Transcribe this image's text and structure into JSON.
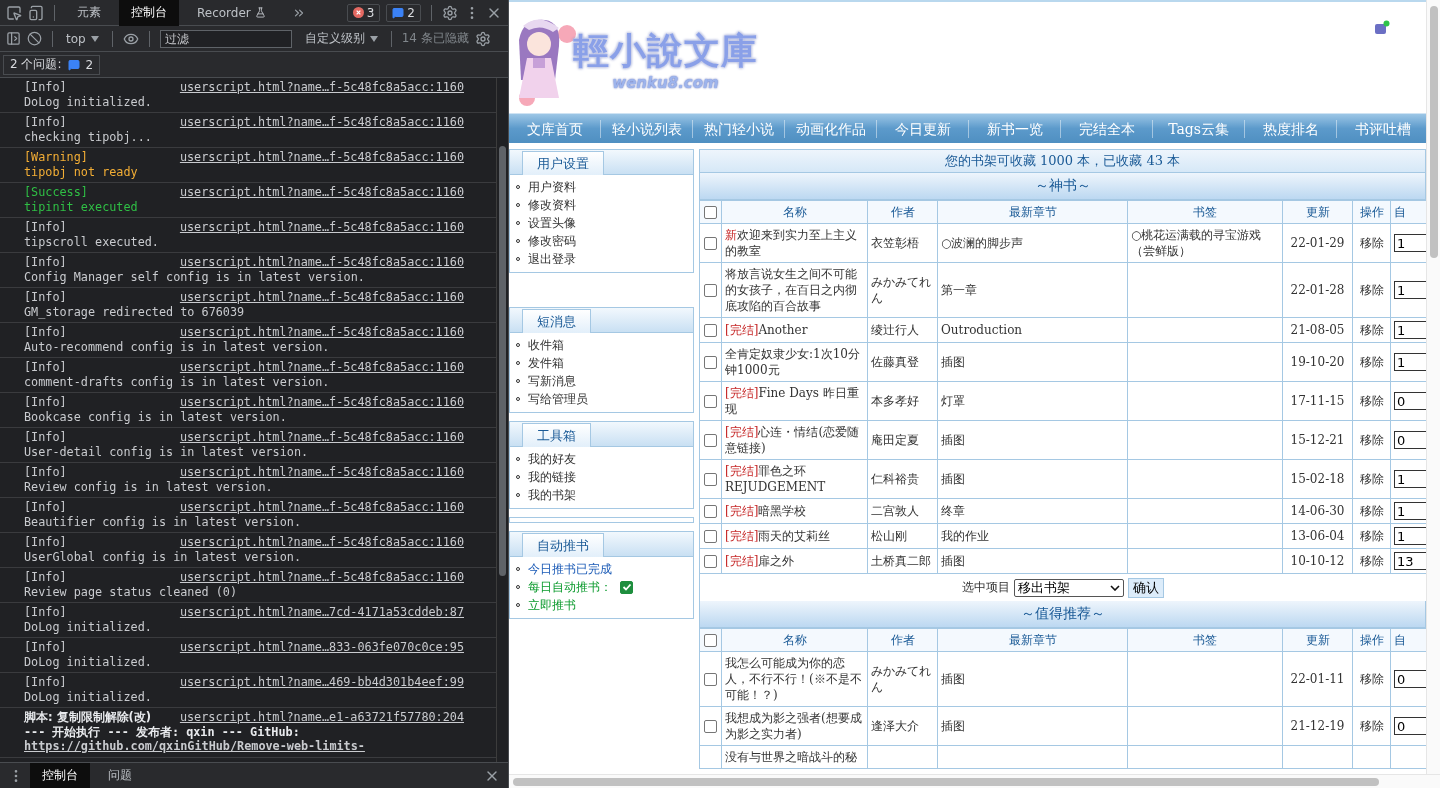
{
  "devtools": {
    "tabs": [
      {
        "label": "元素",
        "selected": false
      },
      {
        "label": "控制台",
        "selected": true
      },
      {
        "label": "Recorder",
        "selected": false
      }
    ],
    "error_count": "3",
    "message_count": "2",
    "context": "top",
    "filter_placeholder": "过滤",
    "levels": "自定义级别",
    "hidden": "14 条已隐藏",
    "issues": {
      "label": "2 个问题:",
      "count": "2"
    },
    "logs": [
      {
        "kind": "info",
        "level": "[Info]",
        "message": "DoLog initialized.",
        "source": "userscript.html?name…f-5c48fc8a5acc:1160"
      },
      {
        "kind": "info",
        "level": "[Info]",
        "message": "checking tipobj...",
        "source": "userscript.html?name…f-5c48fc8a5acc:1160"
      },
      {
        "kind": "warning",
        "level": "[Warning]",
        "message": "tipobj not ready",
        "source": "userscript.html?name…f-5c48fc8a5acc:1160"
      },
      {
        "kind": "success",
        "level": "[Success]",
        "message": "tipinit executed",
        "source": "userscript.html?name…f-5c48fc8a5acc:1160"
      },
      {
        "kind": "info",
        "level": "[Info]",
        "message": "tipscroll executed.",
        "source": "userscript.html?name…f-5c48fc8a5acc:1160"
      },
      {
        "kind": "info",
        "level": "[Info]",
        "message": "Config Manager self config is in latest version.",
        "source": "userscript.html?name…f-5c48fc8a5acc:1160"
      },
      {
        "kind": "info",
        "level": "[Info]",
        "message": "GM_storage redirected to 676039",
        "source": "userscript.html?name…f-5c48fc8a5acc:1160"
      },
      {
        "kind": "info",
        "level": "[Info]",
        "message": "Auto-recommend config is in latest version.",
        "source": "userscript.html?name…f-5c48fc8a5acc:1160"
      },
      {
        "kind": "info",
        "level": "[Info]",
        "message": "comment-drafts config is in latest version.",
        "source": "userscript.html?name…f-5c48fc8a5acc:1160"
      },
      {
        "kind": "info",
        "level": "[Info]",
        "message": "Bookcase config is in latest version.",
        "source": "userscript.html?name…f-5c48fc8a5acc:1160"
      },
      {
        "kind": "info",
        "level": "[Info]",
        "message": "User-detail config is in latest version.",
        "source": "userscript.html?name…f-5c48fc8a5acc:1160"
      },
      {
        "kind": "info",
        "level": "[Info]",
        "message": "Review config is in latest version.",
        "source": "userscript.html?name…f-5c48fc8a5acc:1160"
      },
      {
        "kind": "info",
        "level": "[Info]",
        "message": "Beautifier config is in latest version.",
        "source": "userscript.html?name…f-5c48fc8a5acc:1160"
      },
      {
        "kind": "info",
        "level": "[Info]",
        "message": "UserGlobal config is in latest version.",
        "source": "userscript.html?name…f-5c48fc8a5acc:1160"
      },
      {
        "kind": "info",
        "level": "[Info]",
        "message": "Review page status cleaned (0)",
        "source": "userscript.html?name…f-5c48fc8a5acc:1160"
      },
      {
        "kind": "info",
        "level": "[Info]",
        "message": "DoLog initialized.",
        "source": "userscript.html?name…7cd-4171a53cddeb:87"
      },
      {
        "kind": "info",
        "level": "[Info]",
        "message": "DoLog initialized.",
        "source": "userscript.html?name…833-063fe070c0ce:95"
      },
      {
        "kind": "info",
        "level": "[Info]",
        "message": "DoLog initialized.",
        "source": "userscript.html?name…469-bb4d301b4eef:99"
      },
      {
        "kind": "script",
        "level": "脚本: 复制限制解除(改)",
        "message": "--- 开始执行 --- 发布者: qxin --- GitHub: ",
        "link": "https://github.com/qxinGitHub/Remove-web-limits-",
        "source": "userscript.html?name…e1-a63721f57780:204"
      }
    ],
    "drawer_tabs": [
      {
        "label": "控制台",
        "selected": true
      },
      {
        "label": "问题",
        "selected": false
      }
    ]
  },
  "page": {
    "logo": {
      "title": "輕小說文庫",
      "subtitle": "wenku8.com"
    },
    "nav": [
      "文库首页",
      "轻小说列表",
      "热门轻小说",
      "动画化作品",
      "今日更新",
      "新书一览",
      "完结全本",
      "Tags云集",
      "热度排名",
      "书评吐槽"
    ],
    "sidebar": [
      {
        "title": "用户设置",
        "items": [
          {
            "kind": "link",
            "label": "用户资料"
          },
          {
            "kind": "link",
            "label": "修改资料"
          },
          {
            "kind": "link",
            "label": "设置头像"
          },
          {
            "kind": "link",
            "label": "修改密码"
          },
          {
            "kind": "link",
            "label": "退出登录"
          }
        ]
      },
      {
        "title": "短消息",
        "items": [
          {
            "kind": "link",
            "label": "收件箱"
          },
          {
            "kind": "link",
            "label": "发件箱"
          },
          {
            "kind": "link",
            "label": "写新消息"
          },
          {
            "kind": "link",
            "label": "写给管理员"
          }
        ]
      },
      {
        "title": "工具箱",
        "items": [
          {
            "kind": "link",
            "label": "我的好友"
          },
          {
            "kind": "link",
            "label": "我的链接"
          },
          {
            "kind": "link",
            "label": "我的书架"
          }
        ]
      },
      {
        "title": "自动推书",
        "items": [
          {
            "kind": "status",
            "label": "今日推书已完成"
          },
          {
            "kind": "toggle",
            "label": "每日自动推书：",
            "checked": true
          },
          {
            "kind": "action",
            "label": "立即推书"
          }
        ]
      }
    ],
    "capacity": "您的书架可收藏 1000 本，已收藏 43 本",
    "sections": [
      {
        "title": "～神书～",
        "all_checked": false,
        "columns": [
          "名称",
          "作者",
          "最新章节",
          "书签",
          "更新",
          "操作",
          "自"
        ],
        "rows": [
          {
            "checked": false,
            "tag": "新",
            "title": "欢迎来到实力至上主义的教室",
            "author": "衣笠彰梧",
            "latest": "○波澜的脚步声",
            "bookmark": "○桃花运满载的寻宝游戏（尝鲜版）",
            "updated": "22-01-29",
            "action": "移除",
            "auto": "1"
          },
          {
            "checked": false,
            "title": "将放言说女生之间不可能的女孩子，在百日之内彻底攻陷的百合故事",
            "author": "みかみてれん",
            "latest": "第一章",
            "updated": "22-01-28",
            "action": "移除",
            "auto": "1"
          },
          {
            "checked": false,
            "tag": "[完结]",
            "title": "Another",
            "author": "绫辻行人",
            "latest": "Outroduction",
            "updated": "21-08-05",
            "action": "移除",
            "auto": "1"
          },
          {
            "checked": false,
            "title": "全肯定奴隶少女:1次10分钟1000元",
            "author": "佐藤真登",
            "latest": "插图",
            "updated": "19-10-20",
            "action": "移除",
            "auto": "1"
          },
          {
            "checked": false,
            "tag": "[完结]",
            "title": "Fine Days 昨日重现",
            "author": "本多孝好",
            "latest": "灯罩",
            "updated": "17-11-15",
            "action": "移除",
            "auto": "0"
          },
          {
            "checked": false,
            "tag": "[完结]",
            "title": "心连・情结(恋爱随意链接)",
            "author": "庵田定夏",
            "latest": "插图",
            "updated": "15-12-21",
            "action": "移除",
            "auto": "0"
          },
          {
            "checked": false,
            "tag": "[完结]",
            "title": "罪色之环REJUDGEMENT",
            "author": "仁科裕贵",
            "latest": "插图",
            "updated": "15-02-18",
            "action": "移除",
            "auto": "1"
          },
          {
            "checked": false,
            "tag": "[完结]",
            "title": "暗黑学校",
            "author": "二宫敦人",
            "latest": "终章",
            "updated": "14-06-30",
            "action": "移除",
            "auto": "1"
          },
          {
            "checked": false,
            "tag": "[完结]",
            "title": "雨天的艾莉丝",
            "author": "松山刚",
            "latest": "我的作业",
            "updated": "13-06-04",
            "action": "移除",
            "auto": "1"
          },
          {
            "checked": false,
            "tag": "[完结]",
            "title": "扉之外",
            "author": "土桥真二郎",
            "latest": "插图",
            "updated": "10-10-12",
            "action": "移除",
            "auto": "13"
          }
        ],
        "batch": {
          "label": "选中项目",
          "action": "移出书架",
          "button": "确认"
        }
      },
      {
        "title": "～值得推荐～",
        "all_checked": false,
        "columns": [
          "名称",
          "作者",
          "最新章节",
          "书签",
          "更新",
          "操作",
          "自"
        ],
        "rows": [
          {
            "checked": false,
            "title": "我怎么可能成为你的恋人，不行不行！(※不是不可能！？)",
            "author": "みかみてれん",
            "latest": "插图",
            "updated": "22-01-11",
            "action": "移除",
            "auto": "0"
          },
          {
            "checked": false,
            "title": "我想成为影之强者(想要成为影之实力者)",
            "author": "逢泽大介",
            "latest": "插图",
            "updated": "21-12-19",
            "action": "移除",
            "auto": "0"
          },
          {
            "title": "没有与世界之暗战斗的秘"
          }
        ]
      }
    ]
  }
}
